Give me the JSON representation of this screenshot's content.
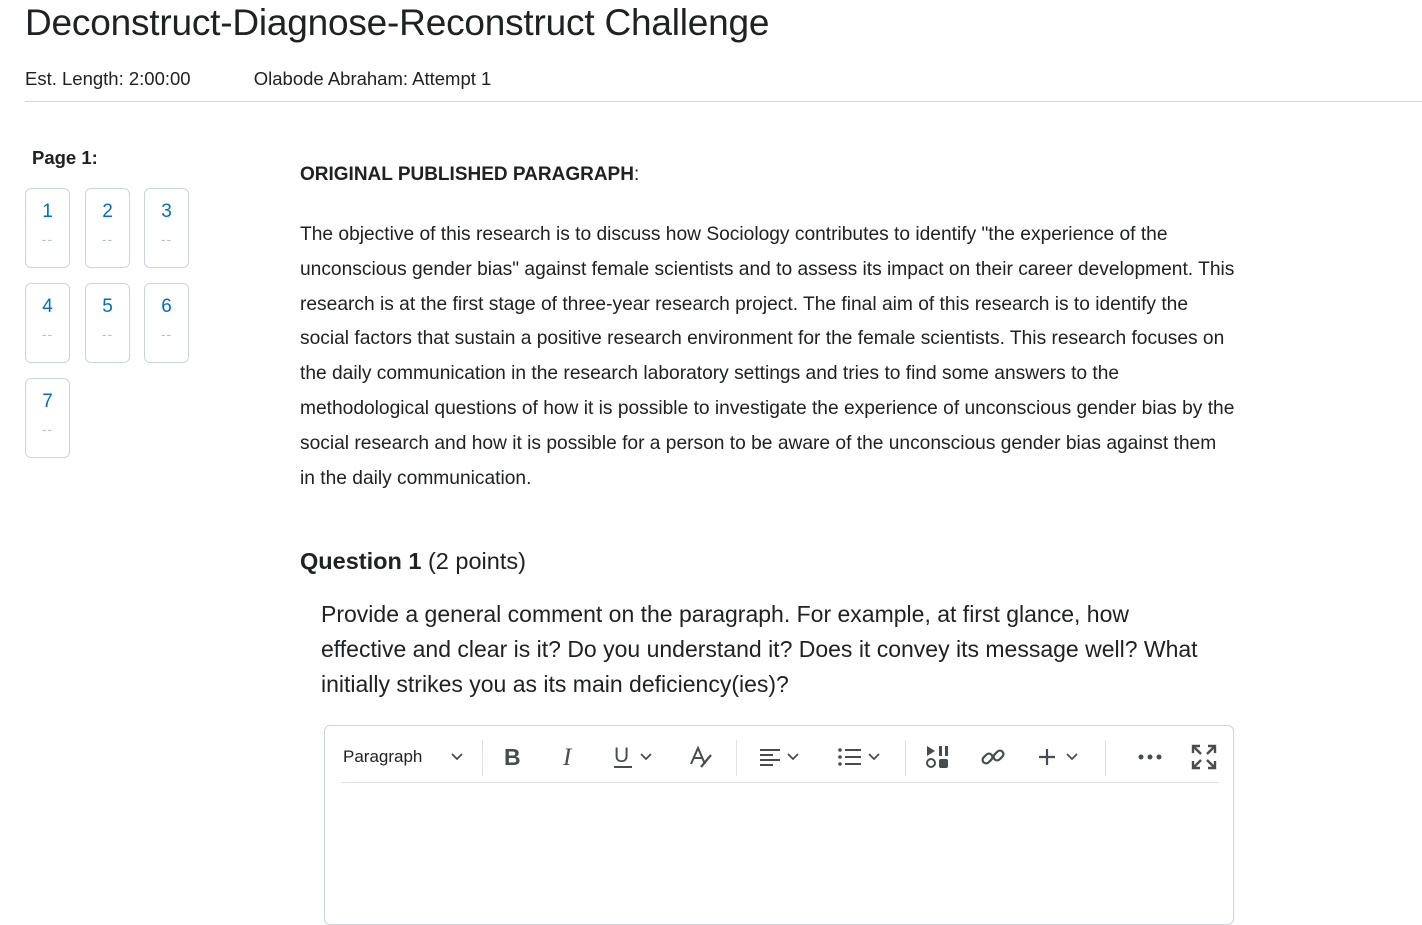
{
  "header": {
    "title": "Deconstruct-Diagnose-Reconstruct Challenge",
    "est_length": "Est. Length: 2:00:00",
    "attempt": "Olabode Abraham: Attempt 1"
  },
  "sidebar": {
    "page_label": "Page 1:",
    "questions": [
      {
        "num": "1",
        "status": "--"
      },
      {
        "num": "2",
        "status": "--"
      },
      {
        "num": "3",
        "status": "--"
      },
      {
        "num": "4",
        "status": "--"
      },
      {
        "num": "5",
        "status": "--"
      },
      {
        "num": "6",
        "status": "--"
      },
      {
        "num": "7",
        "status": "--"
      }
    ]
  },
  "main": {
    "section_heading": "ORIGINAL PUBLISHED PARAGRAPH",
    "section_colon": ":",
    "paragraph": "The objective of this research is to discuss how Sociology contributes to identify \"the experience of the unconscious gender bias\" against female scientists and to assess its impact on their career development. This research is at the first stage of three-year research project. The final aim of this research is to identify the social factors that sustain a positive research environment for the female scientists. This research focuses on the daily communication in the research laboratory settings and tries to find some answers to the methodological questions of how it is possible to investigate the experience of unconscious gender bias by the social research and how it is possible for a person to be aware of the unconscious gender bias against them in the daily communication.",
    "question": {
      "label": "Question 1",
      "points": "(2 points)",
      "text": "Provide a general comment on the paragraph. For example, at first glance, how effective and clear is it? Do you understand it? Does it convey its message well? What initially strikes you as its main deficiency(ies)?"
    },
    "editor": {
      "block_format": "Paragraph",
      "toolbar_icons": [
        "bold-icon",
        "italic-icon",
        "underline-icon",
        "text-style-icon",
        "align-icon",
        "list-icon",
        "media-icon",
        "link-icon",
        "insert-icon",
        "more-icon",
        "fullscreen-icon"
      ]
    }
  }
}
